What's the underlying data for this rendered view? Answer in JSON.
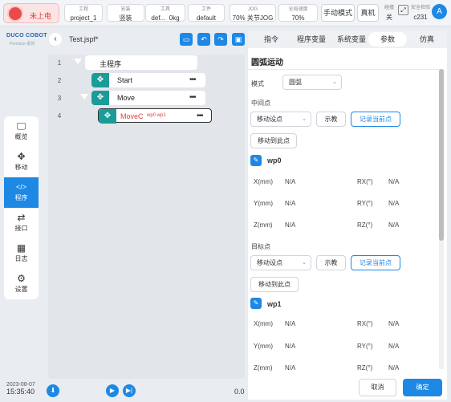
{
  "topbar": {
    "estop_label": "未上电",
    "project": {
      "cap": "工程",
      "val": "project_1"
    },
    "install": {
      "cap": "安装",
      "val": "竖装"
    },
    "tool": {
      "cap": "工具",
      "val": "def...",
      "val2": "0kg"
    },
    "workpiece": {
      "cap": "工件",
      "val": "default"
    },
    "jog": {
      "cap": "JOG",
      "val": "70%",
      "val2": "关节JOG"
    },
    "global_speed": {
      "cap": "全局速度",
      "val": "70%"
    },
    "manual_mode": "手动模式",
    "real_machine": "真机",
    "collision": {
      "cap": "碰撞",
      "val": "关"
    },
    "safety": {
      "cap": "安全检验",
      "val": "c231"
    },
    "avatar": "A"
  },
  "logo": {
    "name": "DUCO COBOT",
    "sub": "Premium 系列"
  },
  "sidenav": {
    "items": [
      {
        "label": "概览",
        "icon": "monitor-icon"
      },
      {
        "label": "移动",
        "icon": "move-icon"
      },
      {
        "label": "程序",
        "icon": "code-icon"
      },
      {
        "label": "接口",
        "icon": "swap-icon"
      },
      {
        "label": "日志",
        "icon": "calendar-icon"
      },
      {
        "label": "设置",
        "icon": "gear-icon"
      }
    ]
  },
  "datetime": {
    "date": "2023-08-07",
    "time": "15:35:40"
  },
  "program": {
    "filename": "Test.jspf*",
    "tree": [
      {
        "line": "1",
        "label": "主程序"
      },
      {
        "line": "2",
        "label": "Start"
      },
      {
        "line": "3",
        "label": "Move"
      },
      {
        "line": "4",
        "label": "MoveC",
        "params": "wp0 wp1"
      }
    ],
    "footer_value": "0.0"
  },
  "tabs": [
    "指令",
    "程序变量",
    "系统变量",
    "参数",
    "仿真"
  ],
  "params": {
    "title": "圆弧运动",
    "mode_label": "模式",
    "mode_value": "圆弧",
    "mid_label": "中间点",
    "target_label": "目标点",
    "move_setpoint": "移动设点",
    "teach": "示教",
    "record_current": "记录当前点",
    "move_here": "移动到此点",
    "wp0": {
      "name": "wp0",
      "xl": "X(mm)",
      "xv": "N/A",
      "yl": "Y(mm)",
      "yv": "N/A",
      "zl": "Z(mm)",
      "zv": "N/A",
      "rxl": "RX(°)",
      "rxv": "N/A",
      "ryl": "RY(°)",
      "ryv": "N/A",
      "rzl": "RZ(°)",
      "rzv": "N/A"
    },
    "wp1": {
      "name": "wp1",
      "xl": "X(mm)",
      "xv": "N/A",
      "yl": "Y(mm)",
      "yv": "N/A",
      "zl": "Z(mm)",
      "zv": "N/A",
      "rxl": "RX(°)",
      "rxv": "N/A",
      "ryl": "RY(°)",
      "ryv": "N/A",
      "rzl": "RZ(°)",
      "rzv": "N/A"
    },
    "cancel": "取消",
    "confirm": "确定"
  },
  "colors": {
    "accent": "#1e88e5",
    "teal": "#1b9c99",
    "estop": "#e94b4b"
  }
}
